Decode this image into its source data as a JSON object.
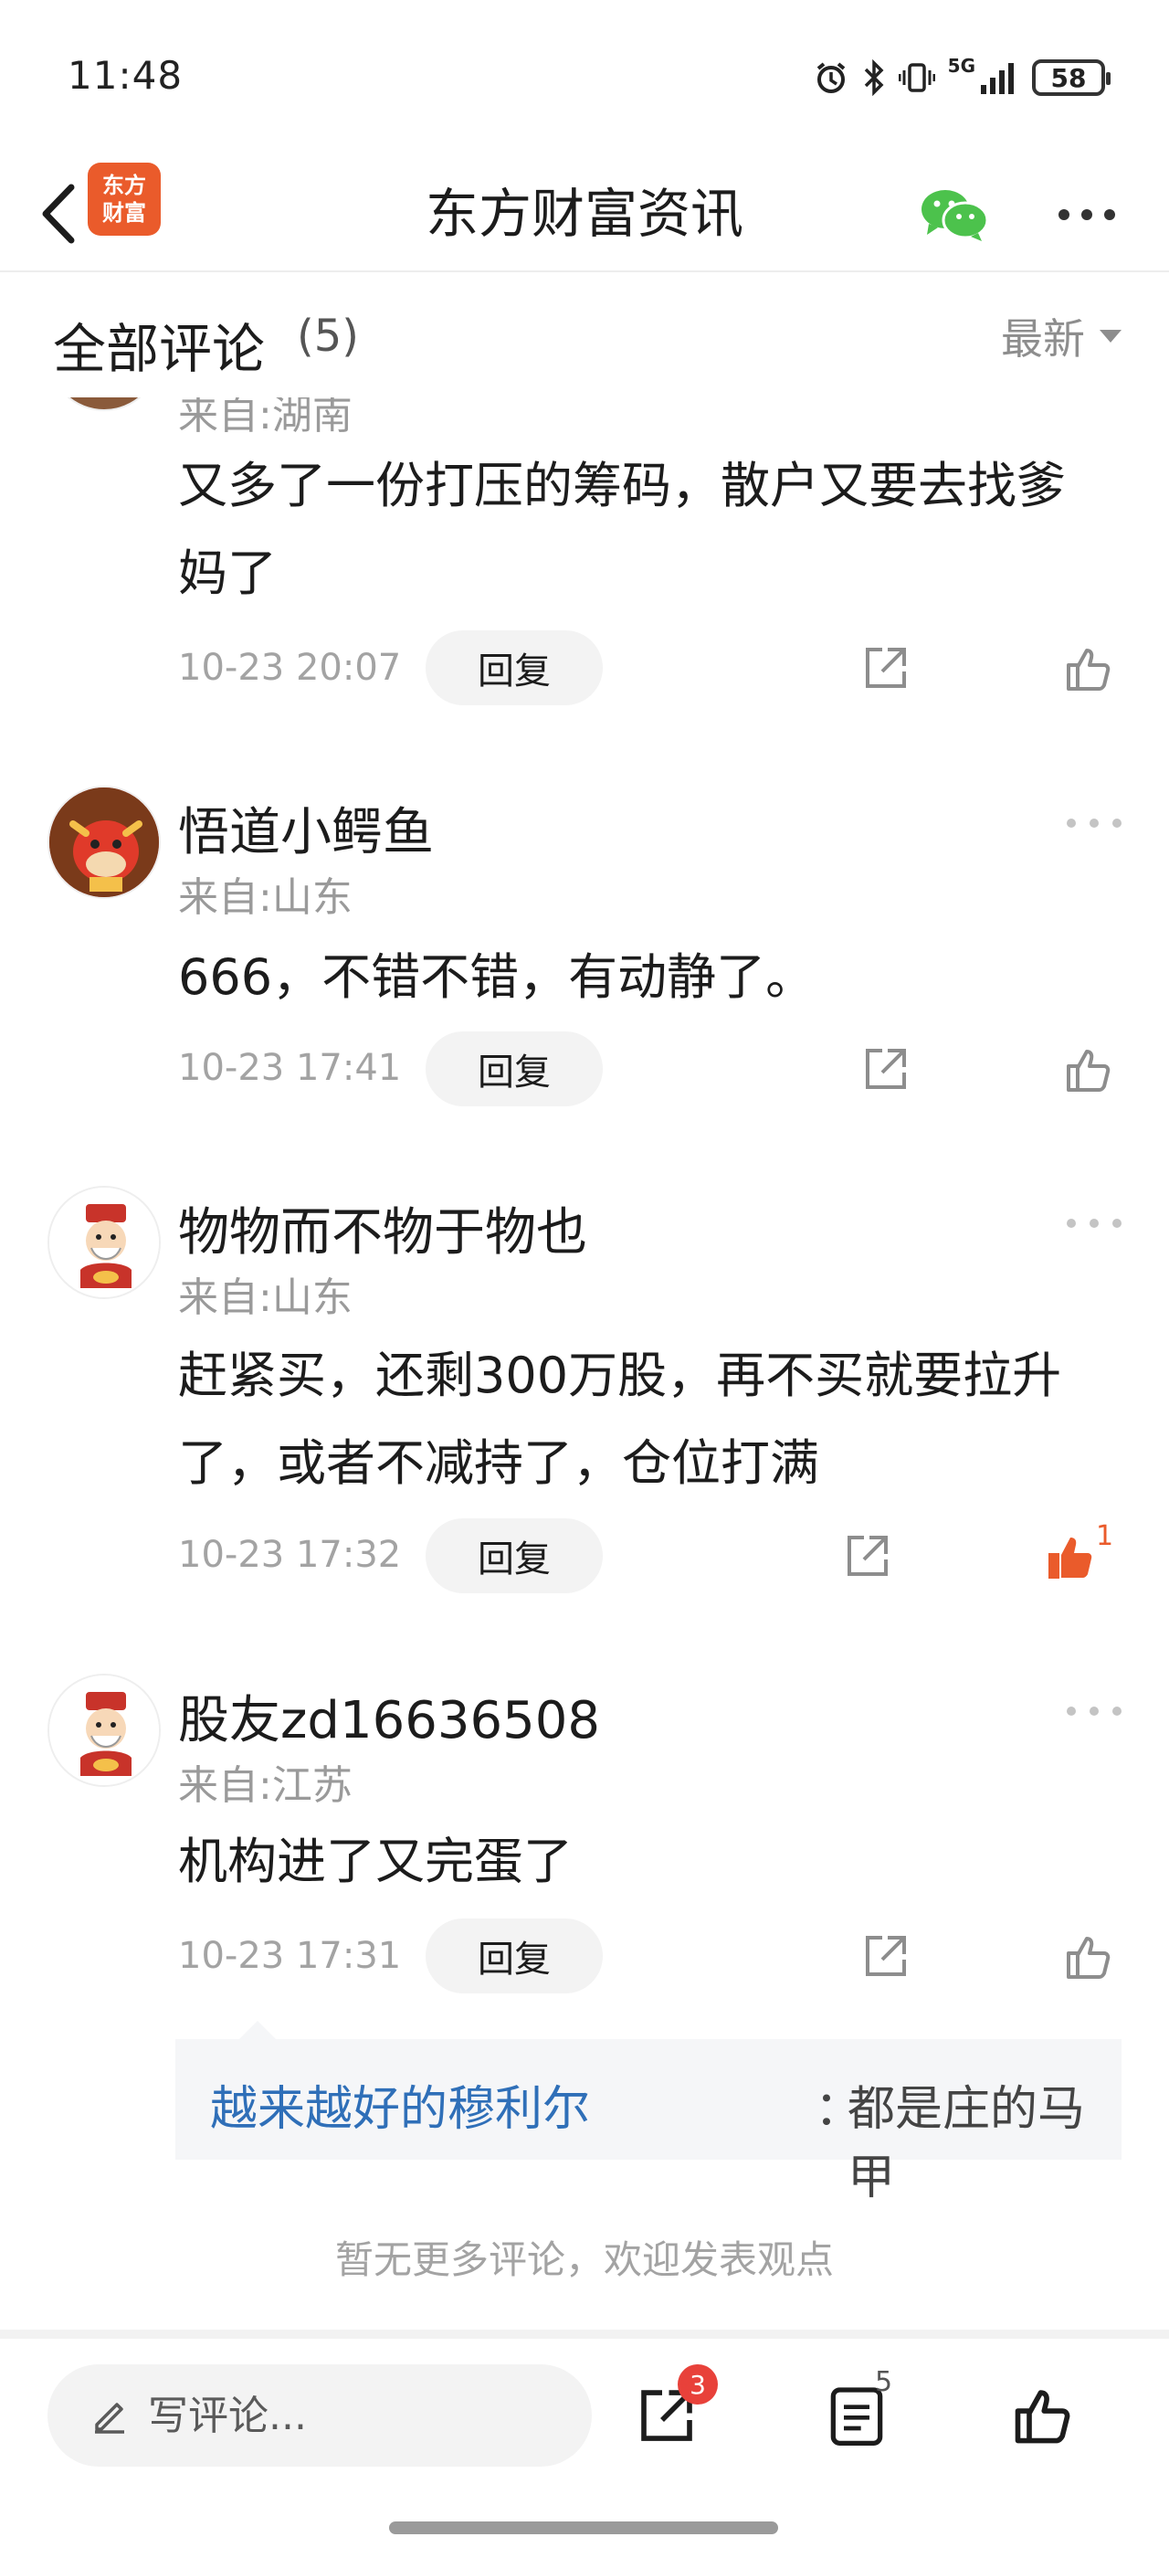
{
  "status_bar": {
    "time": "11:48",
    "network": "5G",
    "battery": "58",
    "icons": [
      "alarm-icon",
      "bluetooth-icon",
      "vibrate-icon",
      "signal-icon",
      "battery-icon"
    ]
  },
  "nav": {
    "logo_text_top": "东方",
    "logo_text_bottom": "财富",
    "title": "东方财富资讯",
    "accent_color": "#ea5b2b",
    "wechat_color": "#4cc24c"
  },
  "comments_header": {
    "title": "全部评论",
    "count": "(5)",
    "sort_label": "最新"
  },
  "comments": [
    {
      "location": "来自:湖南",
      "content": "又多了一份打压的筹码，散户又要去找爹妈了",
      "time": "10-23 20:07",
      "reply_label": "回复"
    },
    {
      "author": "悟道小鳄鱼",
      "location": "来自:山东",
      "content": "666，不错不错，有动静了。",
      "time": "10-23 17:41",
      "reply_label": "回复"
    },
    {
      "author": "物物而不物于物也",
      "location": "来自:山东",
      "content": "赶紧买，还剩300万股，再不买就要拉升了，或者不减持了，仓位打满",
      "time": "10-23 17:32",
      "reply_label": "回复",
      "like_count": "1"
    },
    {
      "author": "股友zd16636508",
      "location": "来自:江苏",
      "content": "机构进了又完蛋了",
      "time": "10-23 17:31",
      "reply_label": "回复",
      "sub_reply": {
        "author": "越来越好的穆利尔",
        "separator": "：",
        "text": "都是庄的马甲"
      }
    }
  ],
  "footer_note": "暂无更多评论，欢迎发表观点",
  "bottom_bar": {
    "input_placeholder": "写评论...",
    "share_badge": "3",
    "comments_badge": "5"
  }
}
